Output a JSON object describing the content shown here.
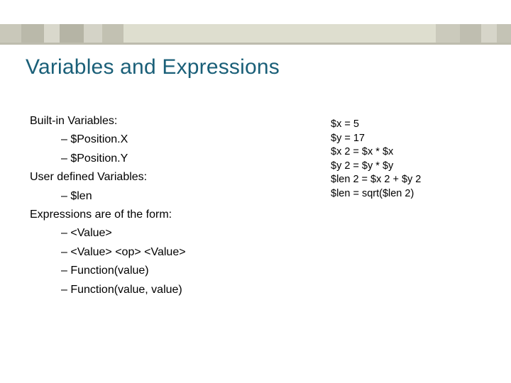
{
  "title": "Variables and Expressions",
  "left": {
    "h1": "Built-in Variables:",
    "b1": "–  $Position.X",
    "b2": "–  $Position.Y",
    "h2": "User defined Variables:",
    "b3": "–   $len",
    "h3": "Expressions are of the form:",
    "b4": "–  <Value>",
    "b5": "–  <Value> <op> <Value>",
    "b6": "–  Function(value)",
    "b7": "–  Function(value, value)"
  },
  "right": {
    "r1": "$x = 5",
    "r2": "$y = 17",
    "r3": "$x 2 = $x * $x",
    "r4": "$y 2 = $y * $y",
    "r5": "$len 2 = $x 2 + $y 2",
    "r6": "$len = sqrt($len 2)"
  }
}
